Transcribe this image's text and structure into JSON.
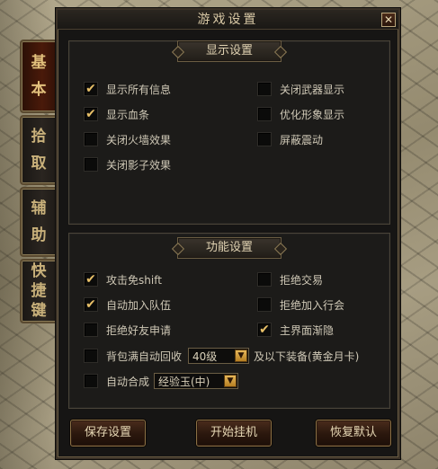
{
  "window": {
    "title": "游戏设置",
    "close_glyph": "✕"
  },
  "tabs": [
    {
      "chars": [
        "基",
        "本"
      ],
      "active": true
    },
    {
      "chars": [
        "拾",
        "取"
      ],
      "active": false
    },
    {
      "chars": [
        "辅",
        "助"
      ],
      "active": false
    },
    {
      "chars": [
        "快",
        "捷",
        "键"
      ],
      "active": false
    }
  ],
  "display_settings": {
    "header": "显示设置",
    "options": [
      {
        "label": "显示所有信息",
        "checked": true
      },
      {
        "label": "关闭武器显示",
        "checked": false
      },
      {
        "label": "显示血条",
        "checked": true
      },
      {
        "label": "优化形象显示",
        "checked": false
      },
      {
        "label": "关闭火墙效果",
        "checked": false
      },
      {
        "label": "屏蔽震动",
        "checked": false
      },
      {
        "label": "关闭影子效果",
        "checked": false
      }
    ]
  },
  "function_settings": {
    "header": "功能设置",
    "options": [
      {
        "label": "攻击免shift",
        "checked": true
      },
      {
        "label": "拒绝交易",
        "checked": false
      },
      {
        "label": "自动加入队伍",
        "checked": true
      },
      {
        "label": "拒绝加入行会",
        "checked": false
      },
      {
        "label": "拒绝好友申请",
        "checked": false
      },
      {
        "label": "主界面渐隐",
        "checked": true
      }
    ],
    "auto_recycle": {
      "label": "背包满自动回收",
      "checked": false,
      "level_value": "40级",
      "suffix": "及以下装备(黄金月卡)"
    },
    "auto_combine": {
      "label": "自动合成",
      "checked": false,
      "item_value": "经验玉(中)"
    }
  },
  "buttons": {
    "save": "保存设置",
    "start": "开始挂机",
    "reset": "恢复默认"
  },
  "check_glyph": "✔",
  "dropdown_glyph": "▼",
  "colors": {
    "accent": "#e8c068",
    "tab_active": "#4a1a0a",
    "window_bg": "#161514"
  }
}
